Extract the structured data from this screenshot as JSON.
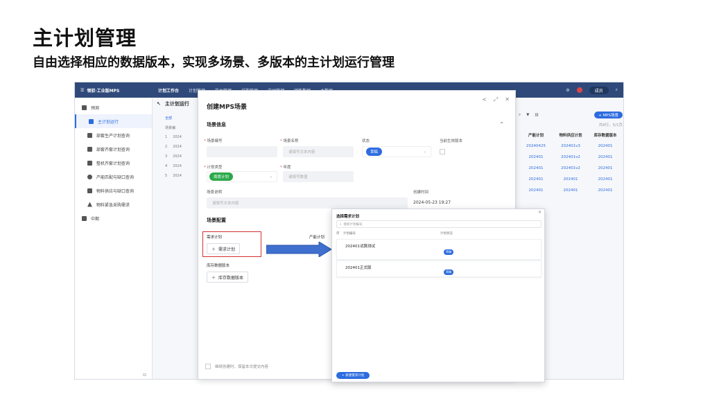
{
  "slide": {
    "title": "主计划管理",
    "subtitle": "自由选择相应的数据版本，实现多场景、多版本的主计划运行管理"
  },
  "topbar": {
    "app_name": "领驭·工业版MPS",
    "nav": [
      "计划工作台",
      "计划管理",
      "能力管理",
      "采购管理",
      "交付管理",
      "销售数据",
      "主数据"
    ],
    "user": "成员"
  },
  "sidebar": {
    "items": [
      {
        "label": "预测",
        "sub": false,
        "active": false
      },
      {
        "label": "主计划运行",
        "sub": true,
        "active": true
      },
      {
        "label": "部套生产计划查询",
        "sub": true,
        "active": false
      },
      {
        "label": "部套齐套计划查询",
        "sub": true,
        "active": false
      },
      {
        "label": "整机齐套计划查询",
        "sub": true,
        "active": false
      },
      {
        "label": "产能匹配与缺口查询",
        "sub": true,
        "active": false
      },
      {
        "label": "物料供应与缺口查询",
        "sub": true,
        "active": false
      },
      {
        "label": "物料紧急采购需求",
        "sub": true,
        "active": false
      },
      {
        "label": "中期",
        "sub": false,
        "active": false
      }
    ]
  },
  "workspace": {
    "tab": "主计划运行",
    "list_filter": "全部",
    "list_header": "场景编",
    "list_rows": [
      {
        "idx": "1",
        "code": "2024"
      },
      {
        "idx": "2",
        "code": "2024"
      },
      {
        "idx": "3",
        "code": "2024"
      },
      {
        "idx": "4",
        "code": "2024"
      },
      {
        "idx": "5",
        "code": "2024"
      }
    ],
    "right_toolbar": {
      "page_info": "共8行，5/1页",
      "new_button": "+ MPS场景"
    },
    "right_headers": [
      "产能计划",
      "物料供应计划",
      "库存数据版本"
    ],
    "right_rows": [
      [
        "20240425",
        "202401v3",
        "202401"
      ],
      [
        "202401",
        "202401v2",
        "202401"
      ],
      [
        "202401",
        "202401v2",
        "202401"
      ],
      [
        "202401",
        "202401",
        "202401"
      ],
      [
        "202401",
        "202401",
        "202401"
      ]
    ]
  },
  "modal": {
    "title": "创建MPS场景",
    "section_info": "场景信息",
    "fields": {
      "code_label": "场景编号",
      "name_label": "场景名称",
      "name_placeholder": "请填写文本内容",
      "status_label": "状态",
      "status_value": "草稿",
      "effective_label": "当前生效版本",
      "type_label": "计划类型",
      "type_value": "周度计划",
      "year_label": "年度",
      "year_placeholder": "请填写数值",
      "desc_label": "场景说明",
      "desc_placeholder": "请填写文本内容",
      "created_label": "创建时间",
      "created_value": "2024-05-23 19:27"
    },
    "section_config": "场景配置",
    "demand_label": "需求计划",
    "demand_button": "需求计划",
    "capacity_label": "产能计划",
    "inventory_label": "库存数据版本",
    "inventory_button": "库存数据版本",
    "footer_check": "继续创建时，保留本次提交内容"
  },
  "popup": {
    "title": "选择需求计划",
    "search_placeholder": "搜索计划编号",
    "col_no": "序",
    "col_name": "计划编号",
    "col_status": "计划状态",
    "rows": [
      {
        "name": "202401试算测试",
        "status": "草稿"
      },
      {
        "name": "202401正式版",
        "status": "草稿"
      }
    ],
    "new_button": "+ 新建需求计划"
  },
  "colors": {
    "accent": "#2d6cdf",
    "topbar": "#2f4a7a",
    "highlight": "#d32f2f",
    "tag_green": "#2ba94a"
  }
}
